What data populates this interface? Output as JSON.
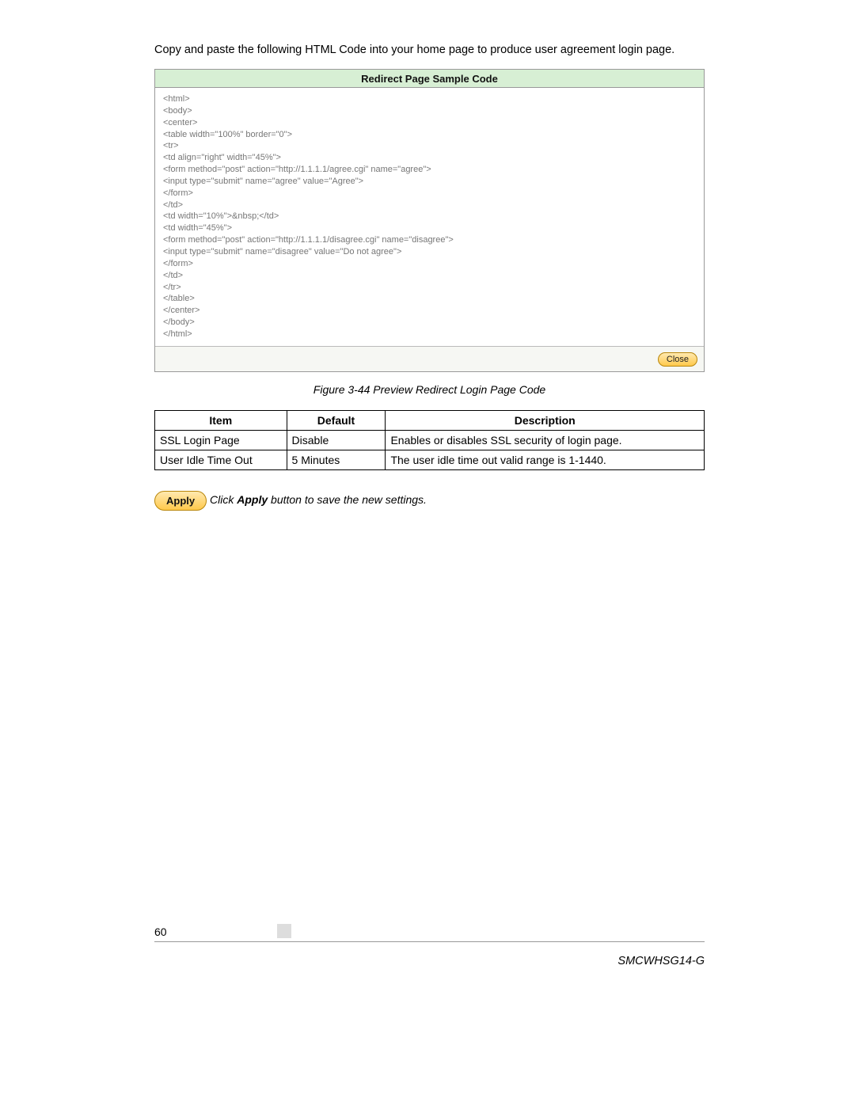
{
  "intro": "Copy and paste the following HTML Code into your home page to produce user agreement login page.",
  "codebox": {
    "title": "Redirect Page Sample Code",
    "code": "<html>\n<body>\n<center>\n<table width=\"100%\" border=\"0\">\n<tr>\n<td align=\"right\" width=\"45%\">\n<form method=\"post\" action=\"http://1.1.1.1/agree.cgi\" name=\"agree\">\n<input type=\"submit\" name=\"agree\" value=\"Agree\">\n</form>\n</td>\n<td width=\"10%\">&nbsp;</td>\n<td width=\"45%\">\n<form method=\"post\" action=\"http://1.1.1.1/disagree.cgi\" name=\"disagree\">\n<input type=\"submit\" name=\"disagree\" value=\"Do not agree\">\n</form>\n</td>\n</tr>\n</table>\n</center>\n</body>\n</html>",
    "close_label": "Close"
  },
  "figure_caption": "Figure 3-44 Preview Redirect Login Page Code",
  "table": {
    "headers": [
      "Item",
      "Default",
      "Description"
    ],
    "rows": [
      {
        "item": "SSL Login Page",
        "default": "Disable",
        "desc": "Enables or disables SSL security of login page."
      },
      {
        "item": "User Idle Time Out",
        "default": "5 Minutes",
        "desc": "The user idle time out valid range is 1-1440."
      }
    ]
  },
  "apply": {
    "button_label": "Apply",
    "text_prefix": "Click ",
    "text_bold": "Apply",
    "text_suffix": " button to save the new settings."
  },
  "footer": {
    "page_number": "60",
    "model": "SMCWHSG14-G"
  }
}
